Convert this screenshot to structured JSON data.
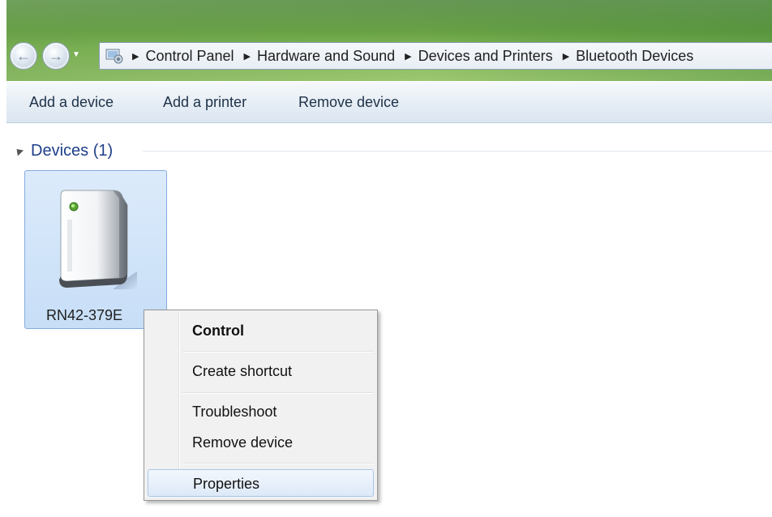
{
  "navigation": {
    "back_icon": "back-arrow-icon",
    "forward_icon": "forward-arrow-icon",
    "dropdown_icon": "chevron-down-icon"
  },
  "address_bar": {
    "location_icon": "control-panel-icon",
    "breadcrumbs": [
      "Control Panel",
      "Hardware and Sound",
      "Devices and Printers",
      "Bluetooth Devices"
    ],
    "separator_icon": "chevron-right-icon"
  },
  "command_bar": {
    "add_device": "Add a device",
    "add_printer": "Add a printer",
    "remove_device": "Remove device"
  },
  "devices_group": {
    "title": "Devices (1)",
    "collapse_icon": "triangle-expanded-icon",
    "items": [
      {
        "label": "RN42-379E",
        "icon": "bluetooth-device-icon",
        "selected": true
      }
    ]
  },
  "context_menu": {
    "items": [
      {
        "label": "Control",
        "bold": true
      },
      {
        "label": "Create shortcut"
      },
      {
        "label": "Troubleshoot"
      },
      {
        "label": "Remove device"
      },
      {
        "label": "Properties",
        "highlighted": true
      }
    ]
  },
  "colors": {
    "selection_fill": "#c7def7",
    "selection_border": "#84acdd",
    "group_title": "#1e3f8a",
    "menu_background": "#f1f1f1",
    "menu_highlight_border": "#a9c6ea"
  }
}
